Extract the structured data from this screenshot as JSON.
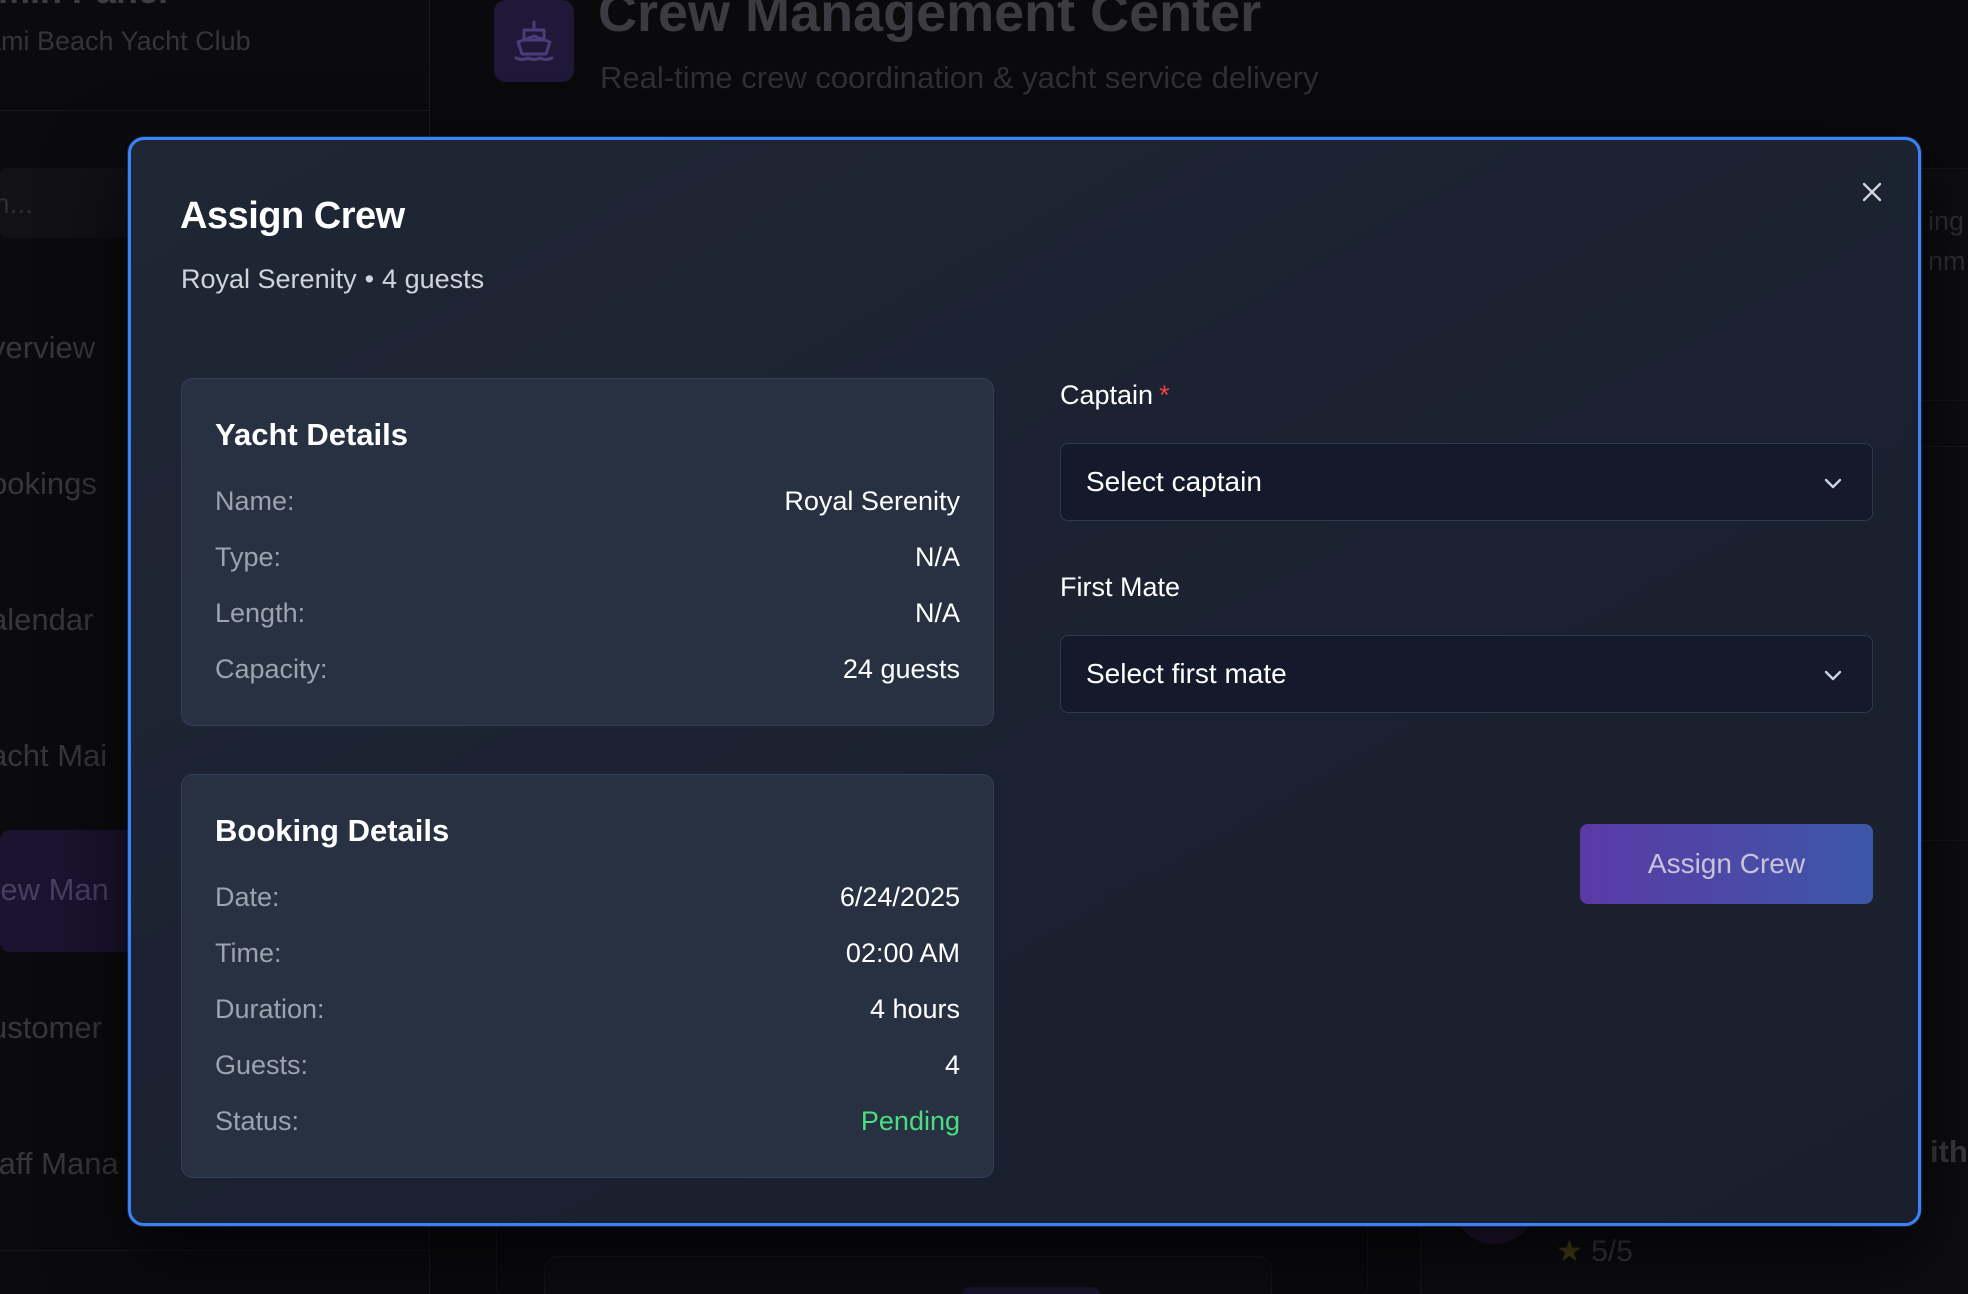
{
  "background": {
    "sidebar": {
      "title": "Admin Panel",
      "title_visible": "dmin Panel",
      "subtitle": "ami Beach Yacht Club",
      "search_placeholder": "h...",
      "items": [
        {
          "label": "verview"
        },
        {
          "label": "ookings"
        },
        {
          "label": "alendar"
        },
        {
          "label": "acht Mai"
        },
        {
          "label": "rew Man"
        },
        {
          "label": "ustomer"
        },
        {
          "label": "taff Mana"
        }
      ]
    },
    "header": {
      "title": "Crew Management Center",
      "subtitle": "Real-time crew coordination & yacht service delivery"
    },
    "right_panel": {
      "text1": "ing",
      "text2": "nm",
      "name_fragment": "ith",
      "rating": "5/5"
    }
  },
  "modal": {
    "title": "Assign Crew",
    "subtitle_yacht": "Royal Serenity",
    "subtitle_separator": "•",
    "subtitle_guests": "4 guests",
    "yacht_details": {
      "title": "Yacht Details",
      "rows": [
        {
          "label": "Name:",
          "value": "Royal Serenity"
        },
        {
          "label": "Type:",
          "value": "N/A"
        },
        {
          "label": "Length:",
          "value": "N/A"
        },
        {
          "label": "Capacity:",
          "value": "24 guests"
        }
      ]
    },
    "booking_details": {
      "title": "Booking Details",
      "rows": [
        {
          "label": "Date:",
          "value": "6/24/2025"
        },
        {
          "label": "Time:",
          "value": "02:00 AM"
        },
        {
          "label": "Duration:",
          "value": "4 hours"
        },
        {
          "label": "Guests:",
          "value": "4"
        },
        {
          "label": "Status:",
          "value": "Pending"
        }
      ]
    },
    "captain": {
      "label": "Captain",
      "required_mark": "*",
      "selected": "Select captain"
    },
    "first_mate": {
      "label": "First Mate",
      "selected": "Select first mate"
    },
    "submit_label": "Assign Crew",
    "colors": {
      "accent_border": "#3b82f6",
      "status_pending": "#4ade80",
      "required": "#ef4444",
      "button_gradient_start": "#5b3aa6",
      "button_gradient_end": "#3d57a8"
    },
    "icons": {
      "close": "close-icon",
      "chevron": "chevron-down-icon",
      "ship": "ship-icon",
      "star": "star-icon"
    }
  }
}
